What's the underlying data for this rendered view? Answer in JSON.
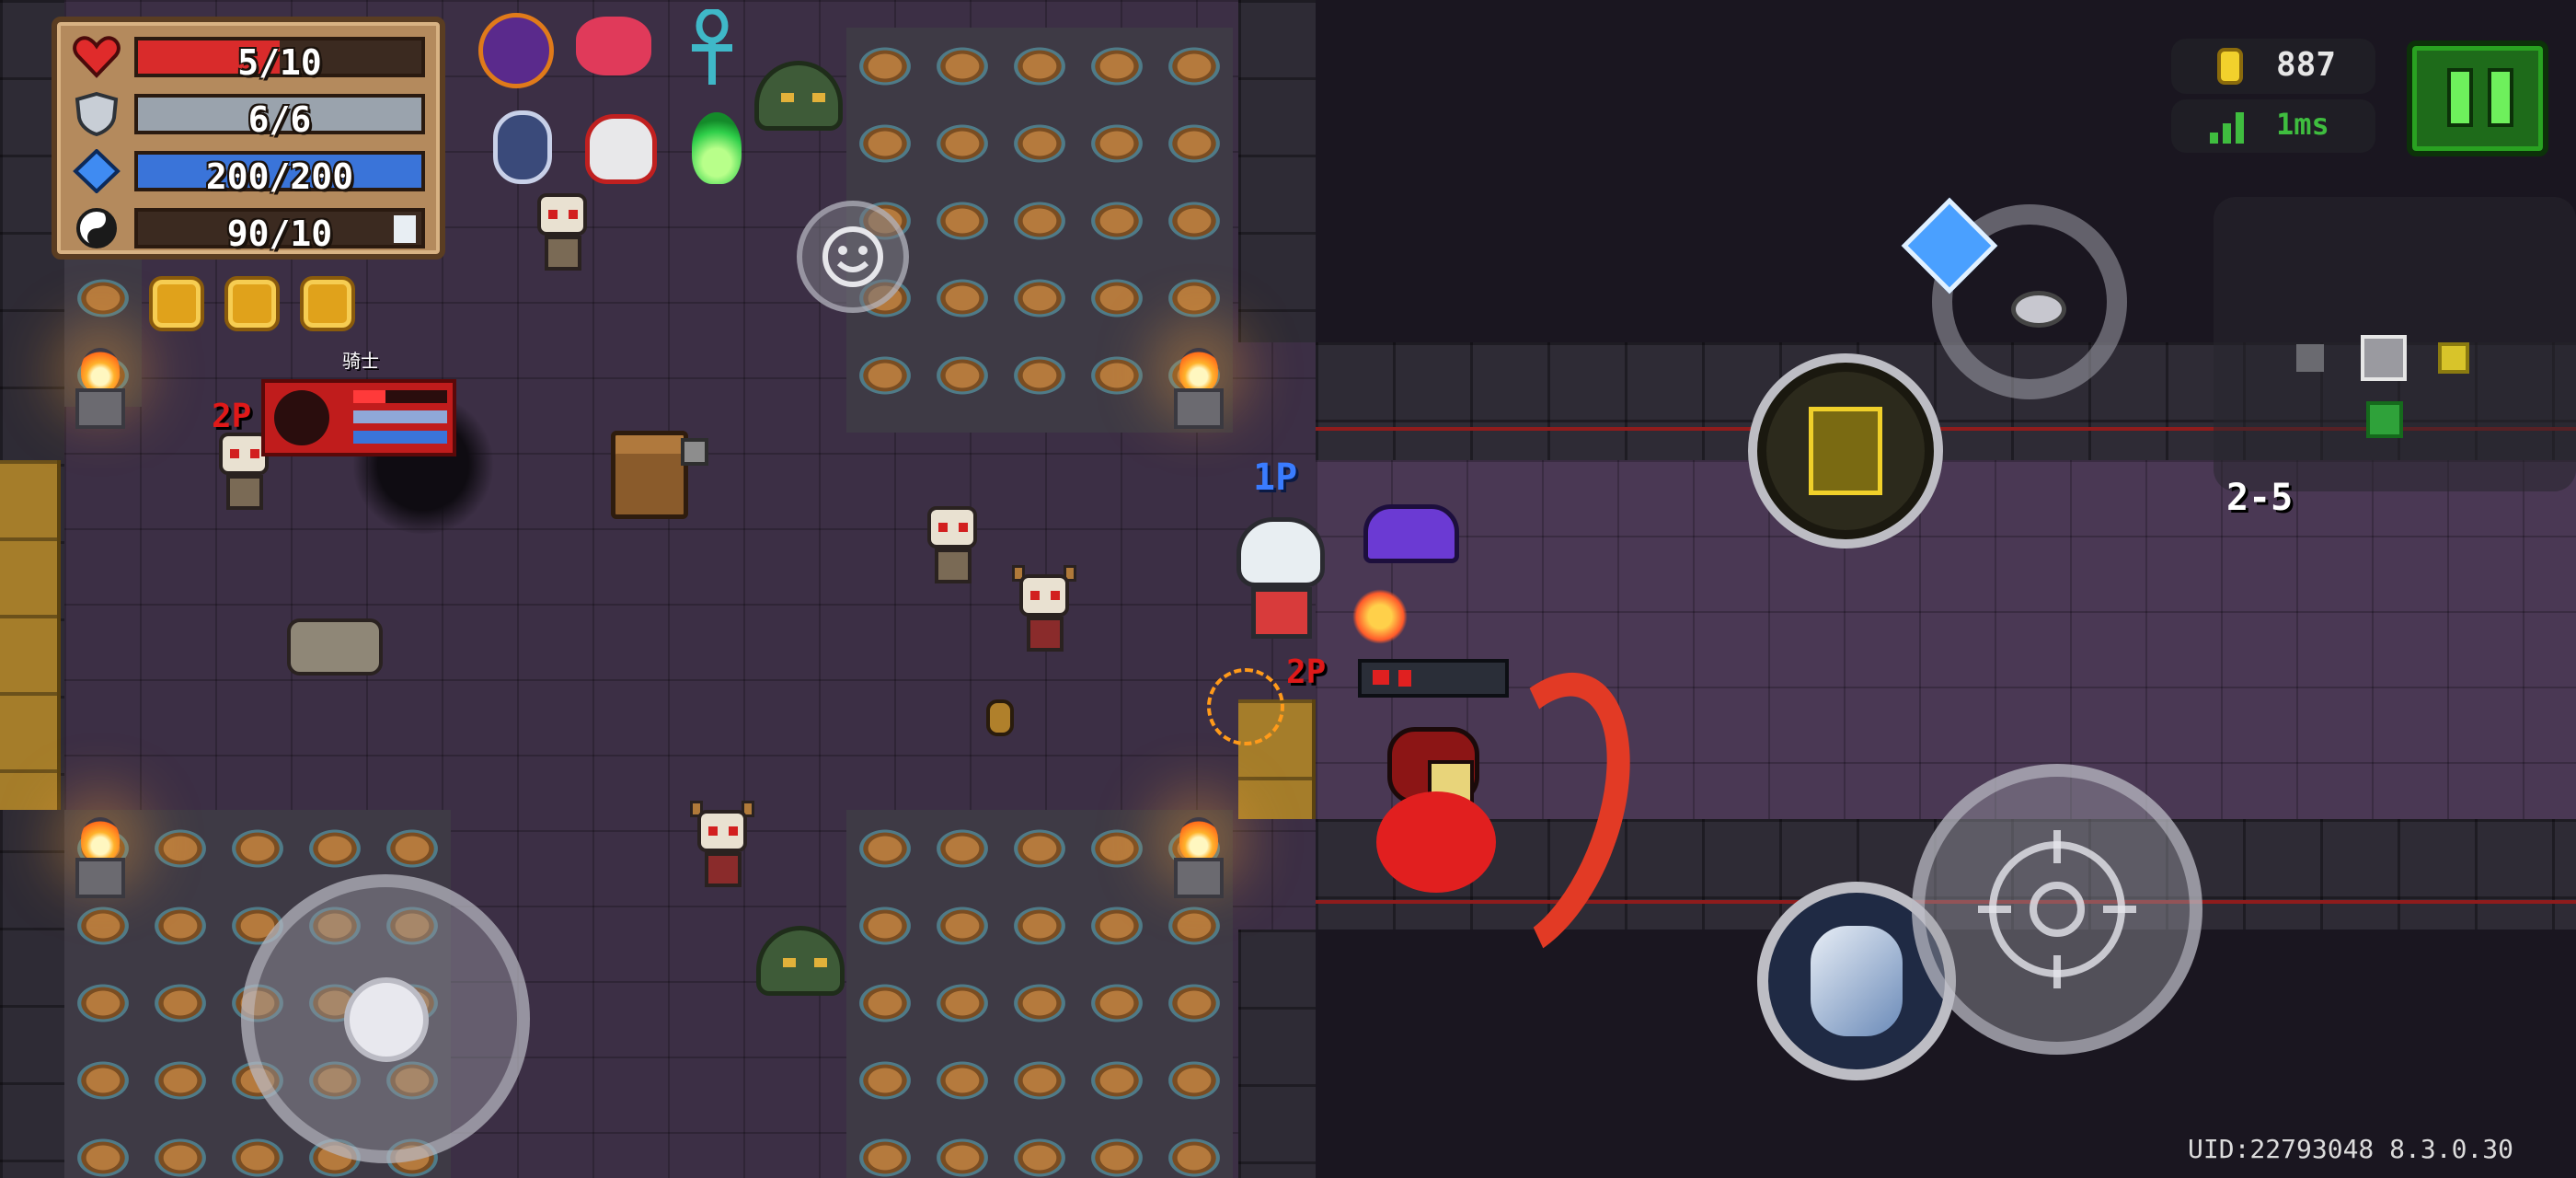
{
  "hud": {
    "stats": [
      {
        "id": "health",
        "icon": "heart-icon",
        "text": "5/10",
        "current": 5,
        "max": 10,
        "color": "#d92b2b"
      },
      {
        "id": "armor",
        "icon": "shield-icon",
        "text": "6/6",
        "current": 6,
        "max": 6,
        "color": "#9aa3ad"
      },
      {
        "id": "energy",
        "icon": "diamond-icon",
        "text": "200/200",
        "current": 200,
        "max": 200,
        "color": "#3a74d9"
      },
      {
        "id": "skill",
        "icon": "yin-yang-icon",
        "text": "90/10",
        "current": 90,
        "max": 10,
        "color": "#e8eef3"
      }
    ],
    "buffs": [
      "demon-helmet-icon",
      "red-flower-icon",
      "ankh-icon",
      "shield-orb-icon",
      "flaming-skull-icon",
      "green-flame-icon"
    ],
    "badges": [
      "gold-badge-1-icon",
      "gold-badge-2-icon",
      "gold-badge-3-icon"
    ],
    "coins": "887",
    "ping": "1ms",
    "level": "2-5",
    "uid": "UID:22793048 8.3.0.30"
  },
  "players": {
    "p1_tag": "1P",
    "p2_tag": "2P",
    "p2_name": "骑士",
    "p2_tag_near": "2P"
  },
  "colors": {
    "accent_green": "#29a221",
    "coin": "#f2d12c",
    "ping": "#3fbd3f"
  }
}
